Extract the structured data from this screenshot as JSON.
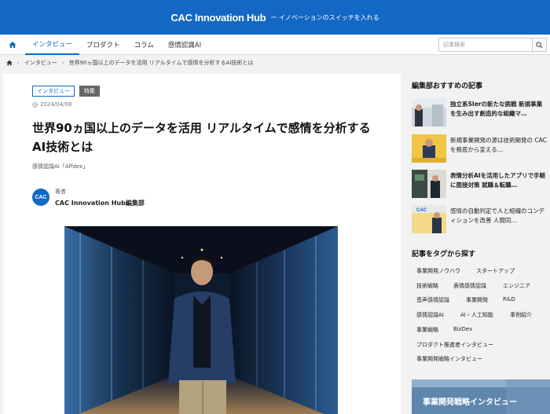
{
  "header": {
    "logo": "CAC Innovation Hub",
    "tagline": "ー イノベーションのスイッチを入れる"
  },
  "nav": {
    "items": [
      {
        "label": "インタビュー",
        "active": true
      },
      {
        "label": "プロダクト",
        "active": false
      },
      {
        "label": "コラム",
        "active": false
      },
      {
        "label": "感情認識AI",
        "active": false
      }
    ],
    "search_placeholder": "記事検索"
  },
  "breadcrumb": {
    "items": [
      "インタビュー",
      "世界90ヵ国以上のデータを活用 リアルタイムで感情を分析するAI技術とは"
    ]
  },
  "article": {
    "tags": [
      "インタビュー",
      "特集"
    ],
    "date": "2024/04/08",
    "title": "世界90ヵ国以上のデータを活用 リアルタイムで感情を分析するAI技術とは",
    "category": "感情認識AI「Affdex」",
    "author_role": "著者",
    "author_name": "CAC Innovation Hub編集部",
    "author_avatar_text": "CAC"
  },
  "sidebar": {
    "recommended_title": "編集部おすすめの記事",
    "recommended": [
      {
        "text": "独立系SIerの新たな挑戦 新規事業を生み出す創造的な組織マ…",
        "bold": true
      },
      {
        "text": "新規事業開発の源は技術開発の CACを根底から変える…",
        "bold": false
      },
      {
        "text": "表情分析AIを活用したアプリで手軽に面接対策 就職＆転職…",
        "bold": true
      },
      {
        "text": "感情の自動判定で人と組織のコンディションを改善 人間同…",
        "bold": false
      }
    ],
    "tags_title": "記事をタグから探す",
    "tags": [
      "事業開発ノウハウ",
      "スタートアップ",
      "技術戦略",
      "表情感情認識",
      "エンジニア",
      "音声感情認識",
      "事業開発",
      "R&D",
      "感情認識AI",
      "AI・人工知能",
      "事例紹介",
      "事業戦略",
      "BizDev",
      "プロダクト推進者インタビュー",
      "事業開発戦略インタビュー"
    ],
    "banner_text": "事業開発戦略インタビュー"
  },
  "colors": {
    "brand": "#1268c4"
  }
}
